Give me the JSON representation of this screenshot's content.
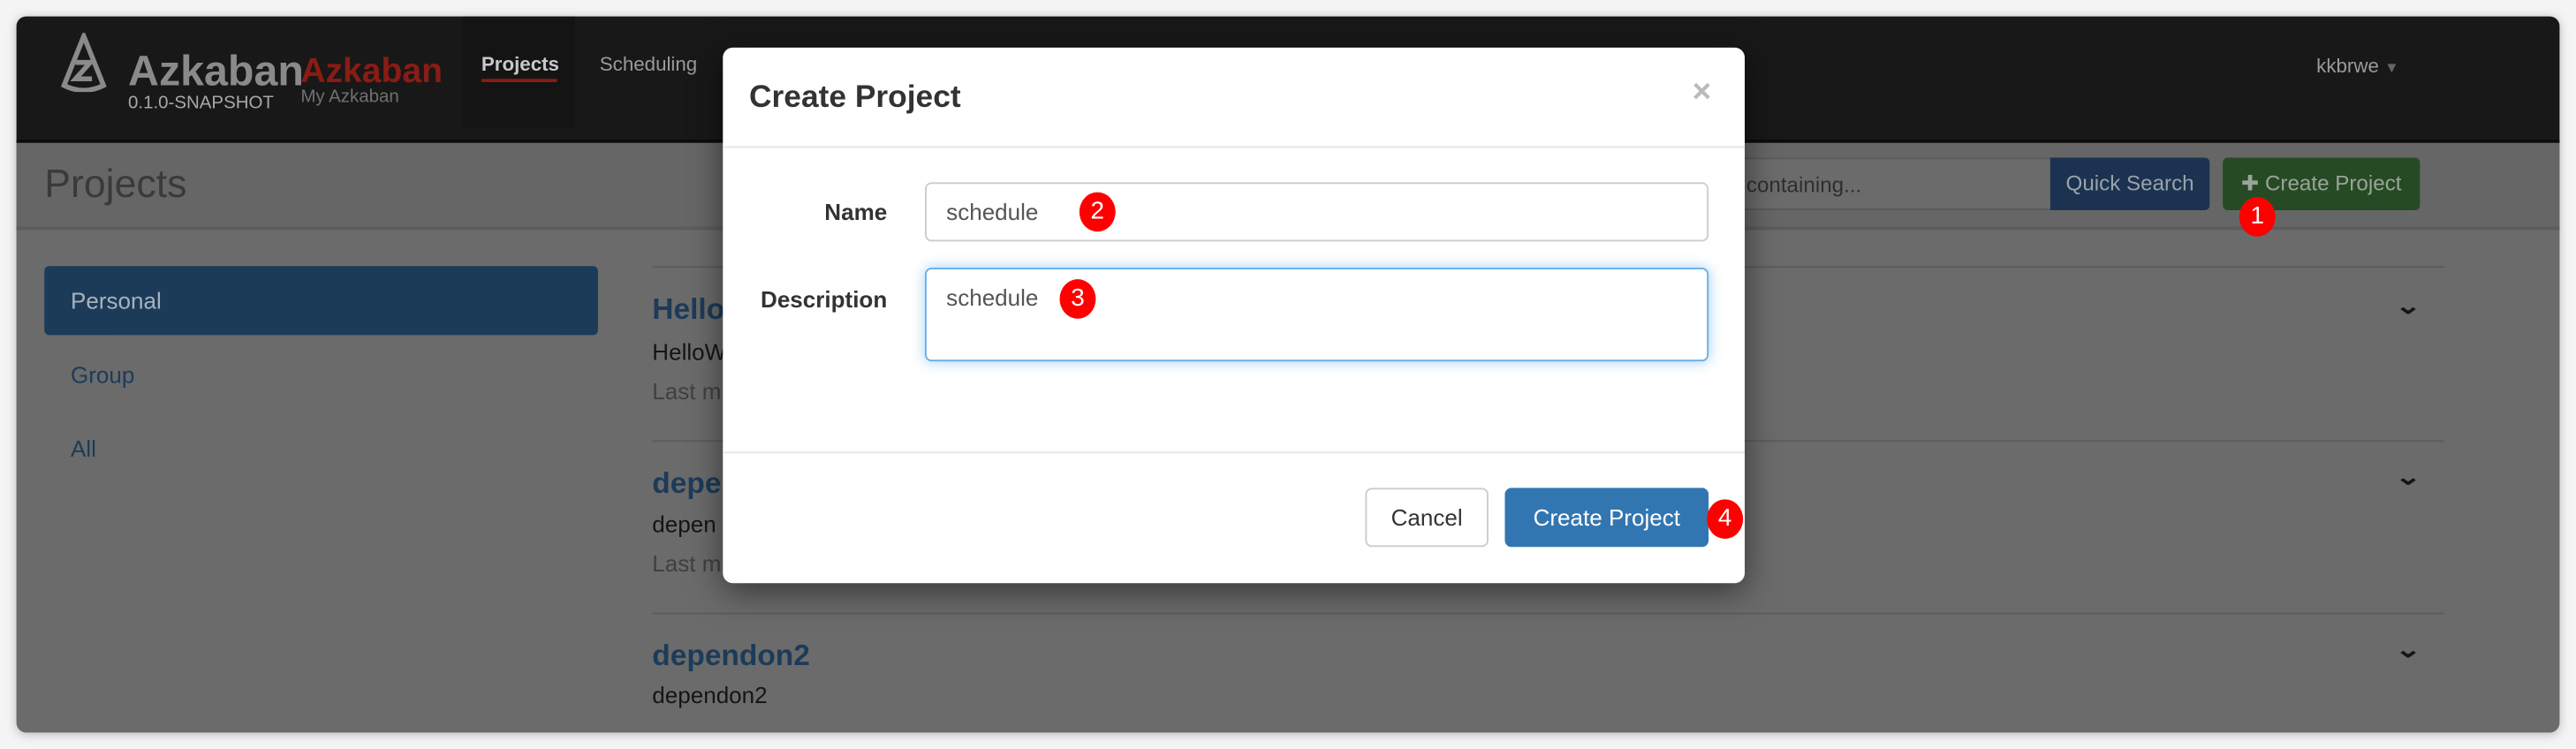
{
  "navbar": {
    "logo_text": "Azkaban",
    "brand_red": "Azkaban",
    "brand_sub": "My Azkaban",
    "version": "0.1.0-SNAPSHOT",
    "tabs": [
      {
        "label": "Projects",
        "active": true
      },
      {
        "label": "Scheduling"
      }
    ],
    "user": "kkbrwe"
  },
  "header": {
    "title": "Projects",
    "search_placeholder": "containing...",
    "quick_search": "Quick Search",
    "create_project": "Create Project"
  },
  "sidebar": {
    "items": [
      {
        "label": "Personal",
        "active": true
      },
      {
        "label": "Group"
      },
      {
        "label": "All"
      }
    ]
  },
  "projects": [
    {
      "title": "Hello",
      "description": "HelloW",
      "meta": "Last m"
    },
    {
      "title": "depe",
      "description": "depen",
      "meta": "Last m"
    },
    {
      "title": "dependon2",
      "description": "dependon2"
    }
  ],
  "modal": {
    "title": "Create Project",
    "close": "×",
    "name_label": "Name",
    "name_value": "schedule",
    "description_label": "Description",
    "description_value": "schedule",
    "cancel": "Cancel",
    "submit": "Create Project"
  },
  "annotations": [
    "1",
    "2",
    "3",
    "4"
  ],
  "colors": {
    "primary": "#428bca",
    "success": "#47a447",
    "brand_red": "#c8201a",
    "annotation": "#ff0000"
  }
}
